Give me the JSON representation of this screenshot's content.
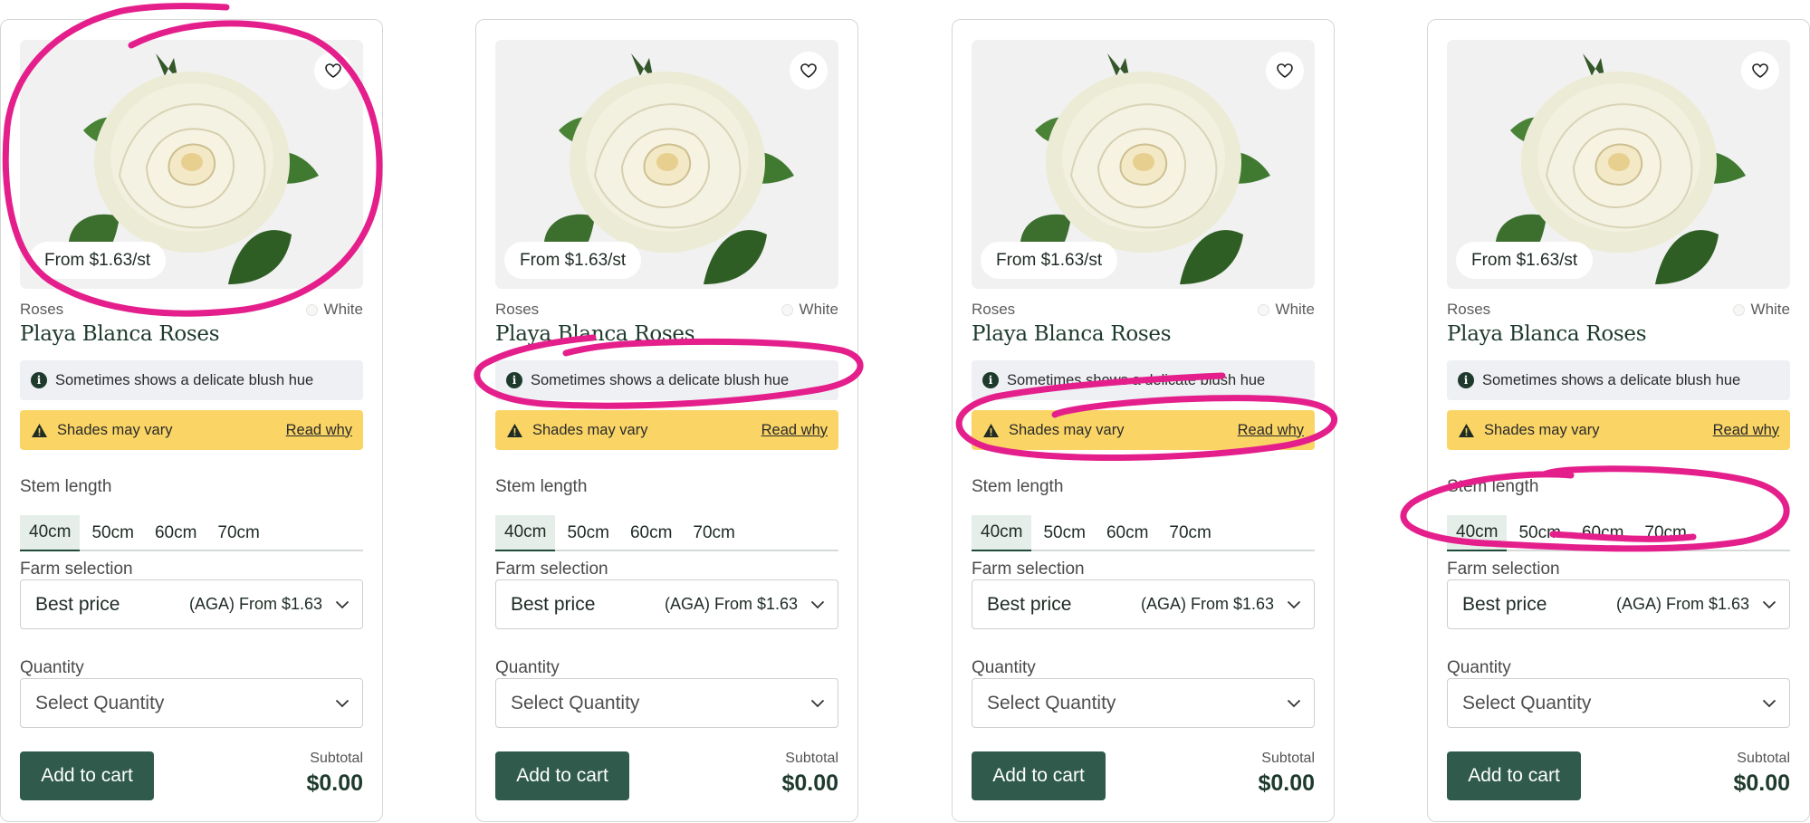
{
  "cards": [
    {
      "price_pill": "From $1.63/st",
      "category": "Roses",
      "color": "White",
      "title": "Playa Blanca Roses",
      "info_text": "Sometimes shows a delicate blush hue",
      "warning_text": "Shades may vary",
      "warning_link": "Read why",
      "stem_label": "Stem length",
      "stem_options": [
        "40cm",
        "50cm",
        "60cm",
        "70cm"
      ],
      "stem_selected": "40cm",
      "farm_label": "Farm selection",
      "farm_value": "Best price",
      "farm_detail": "(AGA) From $1.63",
      "quantity_label": "Quantity",
      "quantity_placeholder": "Select Quantity",
      "add_button": "Add to cart",
      "subtotal_label": "Subtotal",
      "subtotal_value": "$0.00"
    },
    {
      "price_pill": "From $1.63/st",
      "category": "Roses",
      "color": "White",
      "title": "Playa Blanca Roses",
      "info_text": "Sometimes shows a delicate blush hue",
      "warning_text": "Shades may vary",
      "warning_link": "Read why",
      "stem_label": "Stem length",
      "stem_options": [
        "40cm",
        "50cm",
        "60cm",
        "70cm"
      ],
      "stem_selected": "40cm",
      "farm_label": "Farm selection",
      "farm_value": "Best price",
      "farm_detail": "(AGA) From $1.63",
      "quantity_label": "Quantity",
      "quantity_placeholder": "Select Quantity",
      "add_button": "Add to cart",
      "subtotal_label": "Subtotal",
      "subtotal_value": "$0.00"
    },
    {
      "price_pill": "From $1.63/st",
      "category": "Roses",
      "color": "White",
      "title": "Playa Blanca Roses",
      "info_text": "Sometimes shows a delicate blush hue",
      "warning_text": "Shades may vary",
      "warning_link": "Read why",
      "stem_label": "Stem length",
      "stem_options": [
        "40cm",
        "50cm",
        "60cm",
        "70cm"
      ],
      "stem_selected": "40cm",
      "farm_label": "Farm selection",
      "farm_value": "Best price",
      "farm_detail": "(AGA) From $1.63",
      "quantity_label": "Quantity",
      "quantity_placeholder": "Select Quantity",
      "add_button": "Add to cart",
      "subtotal_label": "Subtotal",
      "subtotal_value": "$0.00"
    },
    {
      "price_pill": "From $1.63/st",
      "category": "Roses",
      "color": "White",
      "title": "Playa Blanca Roses",
      "info_text": "Sometimes shows a delicate blush hue",
      "warning_text": "Shades may vary",
      "warning_link": "Read why",
      "stem_label": "Stem length",
      "stem_options": [
        "40cm",
        "50cm",
        "60cm",
        "70cm"
      ],
      "stem_selected": "40cm",
      "farm_label": "Farm selection",
      "farm_value": "Best price",
      "farm_detail": "(AGA) From $1.63",
      "quantity_label": "Quantity",
      "quantity_placeholder": "Select Quantity",
      "add_button": "Add to cart",
      "subtotal_label": "Subtotal",
      "subtotal_value": "$0.00"
    }
  ],
  "colors": {
    "brand_green": "#2f5a4c",
    "title_green": "#1e3a2d",
    "warning_yellow": "#fad566",
    "info_bg": "#eef0f4",
    "annotation_pink": "#e41f8c"
  },
  "icons": {
    "favorite": "heart-icon",
    "info": "info-icon",
    "warning": "warning-triangle-icon",
    "dropdown": "chevron-down-icon"
  }
}
